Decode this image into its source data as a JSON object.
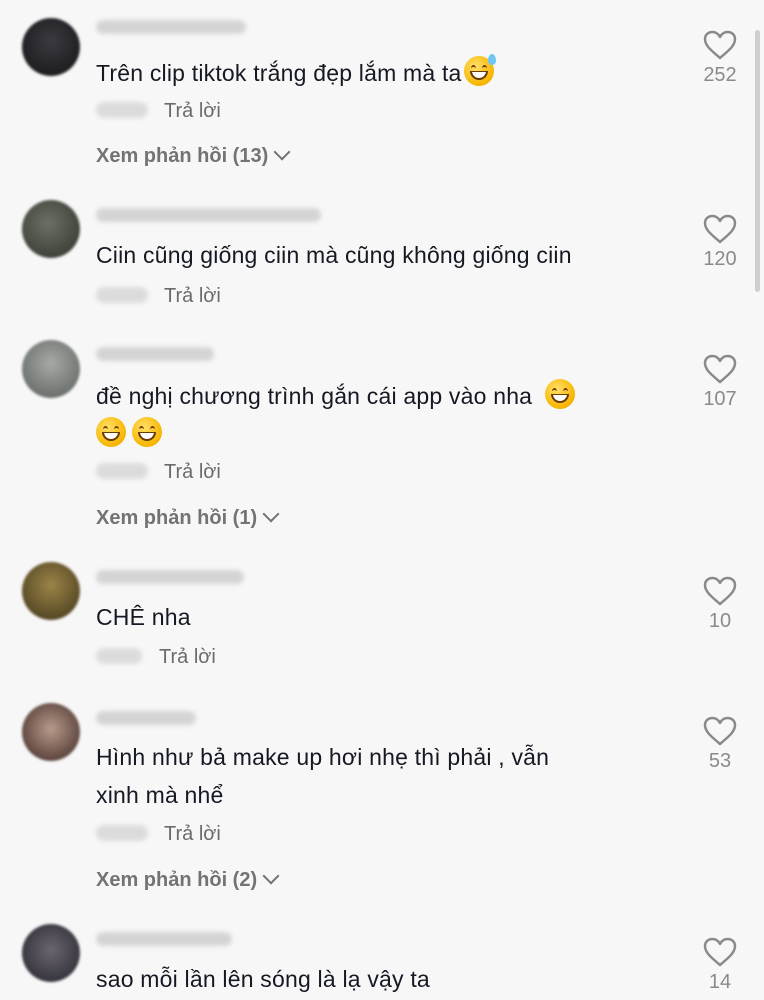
{
  "comments": [
    {
      "text": "Trên clip tiktok trắng đẹp lắm mà ta",
      "emoji": "grinning-sweat-emoji",
      "reply_label": "Trả lời",
      "likes": "252",
      "view_replies": "Xem phản hồi (13)",
      "avatar_color": "#1e1e22"
    },
    {
      "text": "Ciin cũng giống ciin mà cũng không giống ciin",
      "reply_label": "Trả lời",
      "likes": "120",
      "avatar_color": "#4a4f45"
    },
    {
      "text_line1": "đề nghị chương trình gắn cái app vào nha",
      "emoji": "grinning-face-emoji",
      "reply_label": "Trả lời",
      "likes": "107",
      "view_replies": "Xem phản hồi (1)",
      "avatar_color": "#7d827e"
    },
    {
      "text": "CHÊ nha",
      "reply_label": "Trả lời",
      "likes": "10",
      "avatar_color": "#6b5a2e"
    },
    {
      "text_line1": "Hình như bả make up hơi nhẹ thì phải , vẫn",
      "text_line2": "xinh mà nhể",
      "reply_label": "Trả lời",
      "likes": "53",
      "view_replies": "Xem phản hồi (2)",
      "avatar_color": "#5c4740"
    },
    {
      "text": "sao mỗi lần lên sóng là lạ vậy ta",
      "likes": "14",
      "avatar_color": "#3c3a44"
    }
  ],
  "colors": {
    "background": "#f7f7f7",
    "text": "#161823",
    "secondary_text": "#6b6b6b",
    "like_icon": "#8a8a8a"
  },
  "icons": [
    "heart-outline-icon",
    "chevron-down-icon",
    "grinning-face-emoji",
    "grinning-sweat-emoji"
  ]
}
